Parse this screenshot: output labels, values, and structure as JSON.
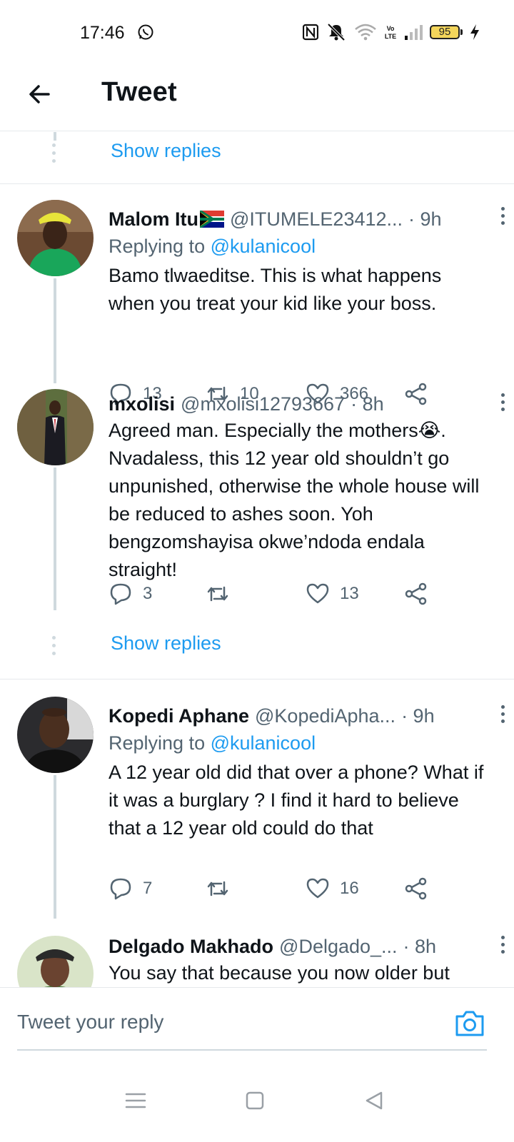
{
  "status_bar": {
    "time": "17:46",
    "battery": "95",
    "icons": [
      "whatsapp-icon",
      "nfc-icon",
      "mute-icon",
      "wifi-icon",
      "volte-icon",
      "signal-icon",
      "battery-icon",
      "charging-icon"
    ]
  },
  "header": {
    "title": "Tweet"
  },
  "top_show_replies": "Show replies",
  "tweets": [
    {
      "name": "Malom Itu",
      "handle": "@ITUMELE23412...",
      "time": "· 9h",
      "replying_prefix": "Replying to ",
      "replying_to": "@kulanicool",
      "text": "Bamo tlwaeditse. This is what happens when you treat your kid like your boss.",
      "replies": "13",
      "retweets": "10",
      "likes": "366"
    },
    {
      "name": "mxolisi",
      "handle": "@mxolisi12793667",
      "time": "· 8h",
      "text_before_emoji": "Agreed man. Especially the mothers",
      "emoji": "😭",
      "text_after_emoji": ". Nvadaless, this 12 year old shouldn’t go unpunished, otherwise the whole house will be reduced to ashes soon. Yoh bengzomshayisa okwe’ndoda endala straight!",
      "replies": "3",
      "retweets": "",
      "likes": "13",
      "show_replies": "Show replies"
    },
    {
      "name": "Kopedi Aphane",
      "handle": "@KopediApha...",
      "time": "· 9h",
      "replying_prefix": "Replying to ",
      "replying_to": "@kulanicool",
      "text": "A 12 year old did that over a phone? What if it was a burglary ? I find it hard to believe that a 12 year old could do that",
      "replies": "7",
      "retweets": "",
      "likes": "16"
    },
    {
      "name": "Delgado Makhado",
      "handle": "@Delgado_...",
      "time": "· 8h",
      "text": "You say that because you now older but"
    }
  ],
  "reply_bar": {
    "placeholder": "Tweet your reply"
  },
  "colors": {
    "accent": "#1d9bf0",
    "secondary_text": "#536471",
    "thread_line": "#cfd9de"
  }
}
